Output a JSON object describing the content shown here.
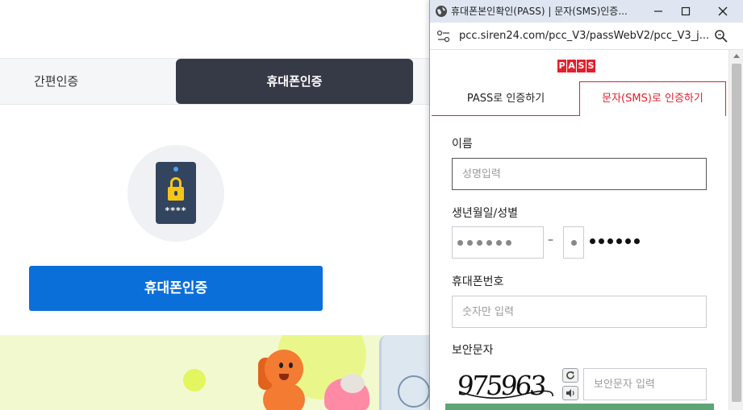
{
  "background_page": {
    "tabs": {
      "simple_auth": "간편인증",
      "phone_auth": "휴대폰인증"
    },
    "phone_icon_stars": "****",
    "verify_button_label": "휴대폰인증"
  },
  "popup": {
    "window_title": "휴대폰본인확인(PASS) | 문자(SMS)인증...",
    "url": "pcc.siren24.com/pcc_V3/passWebV2/pcc_V3_j...",
    "logo_letters": [
      "P",
      "A",
      "S",
      "S"
    ],
    "tabs": {
      "pass": "PASS로 인증하기",
      "sms": "문자(SMS)로 인증하기"
    },
    "form": {
      "name_label": "이름",
      "name_placeholder": "성명입력",
      "dob_label": "생년월일/성별",
      "dob_separator": "–",
      "phone_label": "휴대폰번호",
      "phone_placeholder": "숫자만 입력",
      "captcha_label": "보안문자",
      "captcha_text": "975963",
      "captcha_placeholder": "보안문자 입력"
    },
    "colors": {
      "accent": "#e2202c",
      "titlebar": "#dfe6f1"
    }
  }
}
